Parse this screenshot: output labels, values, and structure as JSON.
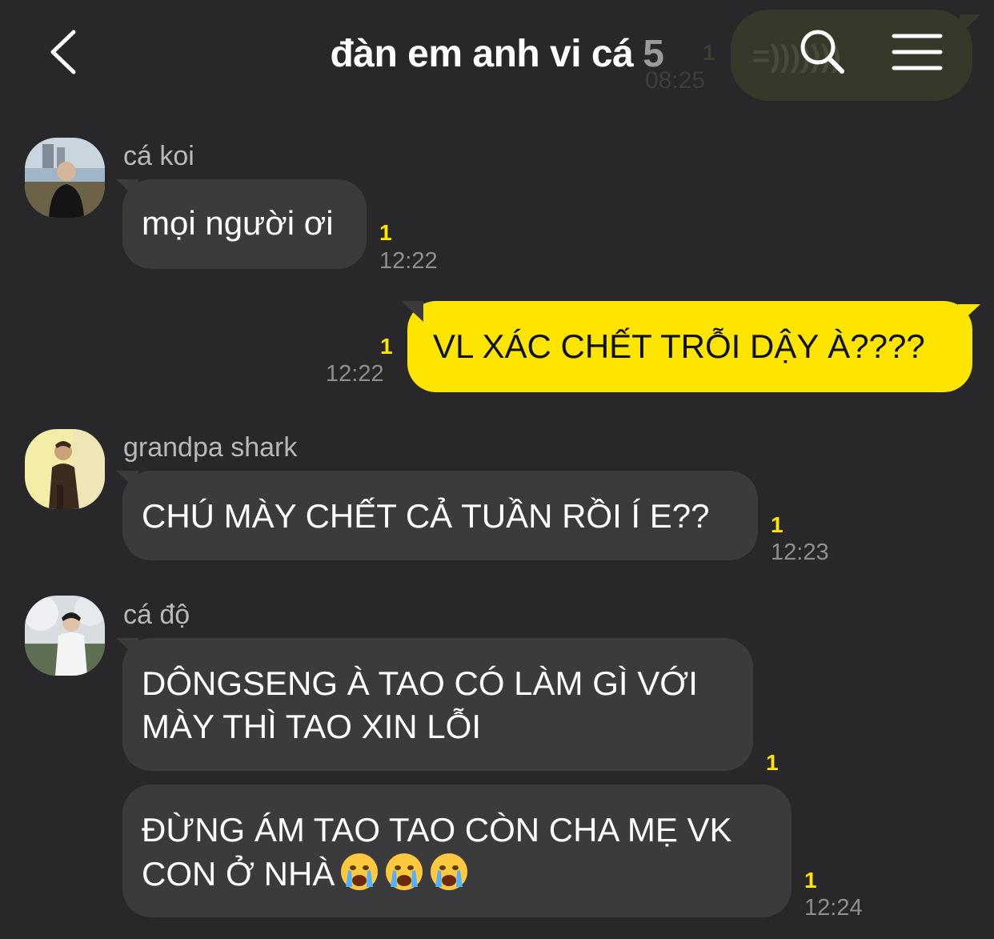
{
  "header": {
    "title": "đàn em anh vi cá",
    "member_count": "5",
    "icons": [
      "back-arrow-icon",
      "search-icon",
      "menu-icon"
    ],
    "background_message": {
      "text": "=)))))))",
      "unread": "1",
      "time": "08:25"
    }
  },
  "theme": {
    "background": "#28282a",
    "incoming_bubble": "#3b3b3d",
    "outgoing_bubble": "#fee500",
    "unread_color": "#fee500"
  },
  "messages": [
    {
      "sender": "cá koi",
      "avatar": "avatar-ca-koi",
      "text": "mọi người ơi",
      "unread": "1",
      "time": "12:22"
    },
    {
      "sender": "me",
      "outgoing": true,
      "text": "VL XÁC CHẾT TRỖI DẬY À????",
      "unread": "1",
      "time": "12:22"
    },
    {
      "sender": "grandpa shark",
      "avatar": "avatar-grandpa-shark",
      "text": "CHÚ MÀY CHẾT CẢ TUẦN RỒI Í E??",
      "unread": "1",
      "time": "12:23"
    },
    {
      "sender": "cá độ",
      "avatar": "avatar-ca-do",
      "lines": [
        "DÔNGSENG À TAO CÓ LÀM GÌ VỚI",
        "MÀY THÌ TAO XIN LỖI"
      ],
      "unread": "1"
    },
    {
      "sender": "cá độ",
      "lines": [
        "ĐỪNG ÁM TAO TAO CÒN CHA MẸ VK",
        "CON Ở NHÀ"
      ],
      "emojis": [
        "crying-face-emoji",
        "crying-face-emoji",
        "crying-face-emoji"
      ],
      "unread": "1",
      "time": "12:24"
    }
  ]
}
